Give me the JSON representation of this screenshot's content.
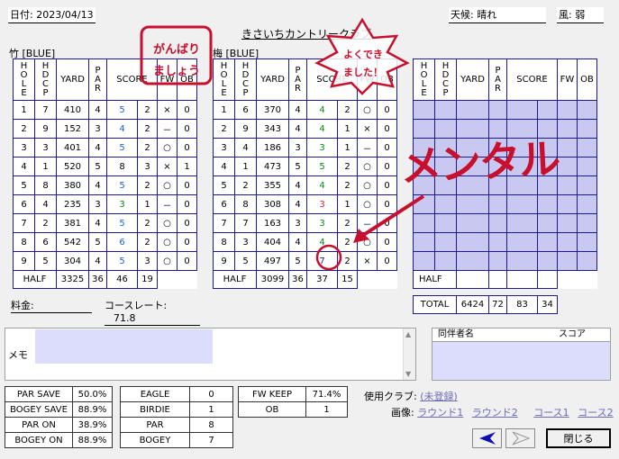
{
  "header": {
    "date": "日付: 2023/04/13",
    "weather": "天候: 晴れ",
    "wind": "風: 弱",
    "course_title": "きさいちカントリークラブ"
  },
  "columns": {
    "hole": "HOLE",
    "hdcp": "HDCP",
    "yard": "YARD",
    "par": "PAR",
    "score": "SCORE",
    "fw": "FW",
    "ob": "OB"
  },
  "front": {
    "name": "竹 [BLUE]",
    "rows": [
      {
        "hole": "1",
        "hdcp": "7",
        "yard": "410",
        "par": "4",
        "score": "5",
        "putt": "2",
        "fw": "×",
        "ob": "0"
      },
      {
        "hole": "2",
        "hdcp": "9",
        "yard": "152",
        "par": "3",
        "score": "4",
        "putt": "2",
        "fw": "－",
        "ob": "0"
      },
      {
        "hole": "3",
        "hdcp": "3",
        "yard": "401",
        "par": "4",
        "score": "5",
        "putt": "2",
        "fw": "○",
        "ob": "0"
      },
      {
        "hole": "4",
        "hdcp": "1",
        "yard": "520",
        "par": "5",
        "score": "8",
        "putt": "3",
        "fw": "×",
        "ob": "1"
      },
      {
        "hole": "5",
        "hdcp": "8",
        "yard": "380",
        "par": "4",
        "score": "5",
        "putt": "2",
        "fw": "○",
        "ob": "0"
      },
      {
        "hole": "6",
        "hdcp": "4",
        "yard": "235",
        "par": "3",
        "score": "3",
        "putt": "1",
        "fw": "－",
        "ob": "0"
      },
      {
        "hole": "7",
        "hdcp": "2",
        "yard": "381",
        "par": "4",
        "score": "5",
        "putt": "2",
        "fw": "○",
        "ob": "0"
      },
      {
        "hole": "8",
        "hdcp": "6",
        "yard": "542",
        "par": "5",
        "score": "6",
        "putt": "2",
        "fw": "○",
        "ob": "0"
      },
      {
        "hole": "9",
        "hdcp": "5",
        "yard": "304",
        "par": "4",
        "score": "5",
        "putt": "3",
        "fw": "○",
        "ob": "0"
      }
    ],
    "half": {
      "label": "HALF",
      "yard": "3325",
      "par": "36",
      "score": "46",
      "putt": "19"
    }
  },
  "back": {
    "name": "梅 [BLUE]",
    "rows": [
      {
        "hole": "1",
        "hdcp": "6",
        "yard": "370",
        "par": "4",
        "score": "4",
        "putt": "2",
        "fw": "○",
        "ob": "0"
      },
      {
        "hole": "2",
        "hdcp": "9",
        "yard": "343",
        "par": "4",
        "score": "4",
        "putt": "1",
        "fw": "×",
        "ob": "0"
      },
      {
        "hole": "3",
        "hdcp": "4",
        "yard": "186",
        "par": "3",
        "score": "3",
        "putt": "1",
        "fw": "－",
        "ob": "0"
      },
      {
        "hole": "4",
        "hdcp": "1",
        "yard": "473",
        "par": "5",
        "score": "5",
        "putt": "2",
        "fw": "○",
        "ob": "0"
      },
      {
        "hole": "5",
        "hdcp": "2",
        "yard": "355",
        "par": "4",
        "score": "4",
        "putt": "2",
        "fw": "○",
        "ob": "0"
      },
      {
        "hole": "6",
        "hdcp": "8",
        "yard": "308",
        "par": "4",
        "score": "3",
        "putt": "1",
        "fw": "○",
        "ob": "0"
      },
      {
        "hole": "7",
        "hdcp": "7",
        "yard": "163",
        "par": "3",
        "score": "3",
        "putt": "2",
        "fw": "－",
        "ob": "0"
      },
      {
        "hole": "8",
        "hdcp": "3",
        "yard": "404",
        "par": "4",
        "score": "4",
        "putt": "2",
        "fw": "○",
        "ob": "0"
      },
      {
        "hole": "9",
        "hdcp": "5",
        "yard": "497",
        "par": "5",
        "score": "7",
        "putt": "2",
        "fw": "×",
        "ob": "0"
      }
    ],
    "half": {
      "label": "HALF",
      "yard": "3099",
      "par": "36",
      "score": "37",
      "putt": "15"
    }
  },
  "extra": {
    "half": "HALF",
    "total_label": "TOTAL",
    "total_yard": "6424",
    "total_par": "72",
    "total_score": "83",
    "total_putt": "34"
  },
  "fee_label": "料金:",
  "course_rate_label": "コースレート:",
  "course_rate_value": "71.8",
  "memo_label": "メモ",
  "companions": {
    "name_col": "同伴者名",
    "score_col": "スコア"
  },
  "stats": {
    "par_save_label": "PAR SAVE",
    "par_save": "50.0%",
    "bogey_save_label": "BOGEY SAVE",
    "bogey_save": "88.9%",
    "par_on_label": "PAR ON",
    "par_on": "38.9%",
    "bogey_on_label": "BOGEY ON",
    "bogey_on": "88.9%",
    "eagle_label": "EAGLE",
    "eagle": "0",
    "birdie_label": "BIRDIE",
    "birdie": "1",
    "par_label": "PAR",
    "par": "8",
    "bogey_label": "BOGEY",
    "bogey": "7",
    "fw_keep_label": "FW KEEP",
    "fw_keep": "71.4%",
    "ob_label": "OB",
    "ob": "1"
  },
  "clubs": {
    "label": "使用クラブ:",
    "value": "(未登録)"
  },
  "images": {
    "label": "画像:",
    "round1": "ラウンド1",
    "round2": "ラウンド2",
    "course1": "コース1",
    "course2": "コース2"
  },
  "buttons": {
    "close": "閉じる"
  },
  "annotations": {
    "ganbari": "がんばり",
    "mashou": "ましょう",
    "yokudeki": "よくでき",
    "mashita": "ました！",
    "mental": "メンタル"
  },
  "colors": {
    "accent_red": "#c8102e",
    "table_border": "#1b1b8c",
    "empty_cell": "#c8c8f0",
    "score_blue": "#1f5fd1"
  }
}
